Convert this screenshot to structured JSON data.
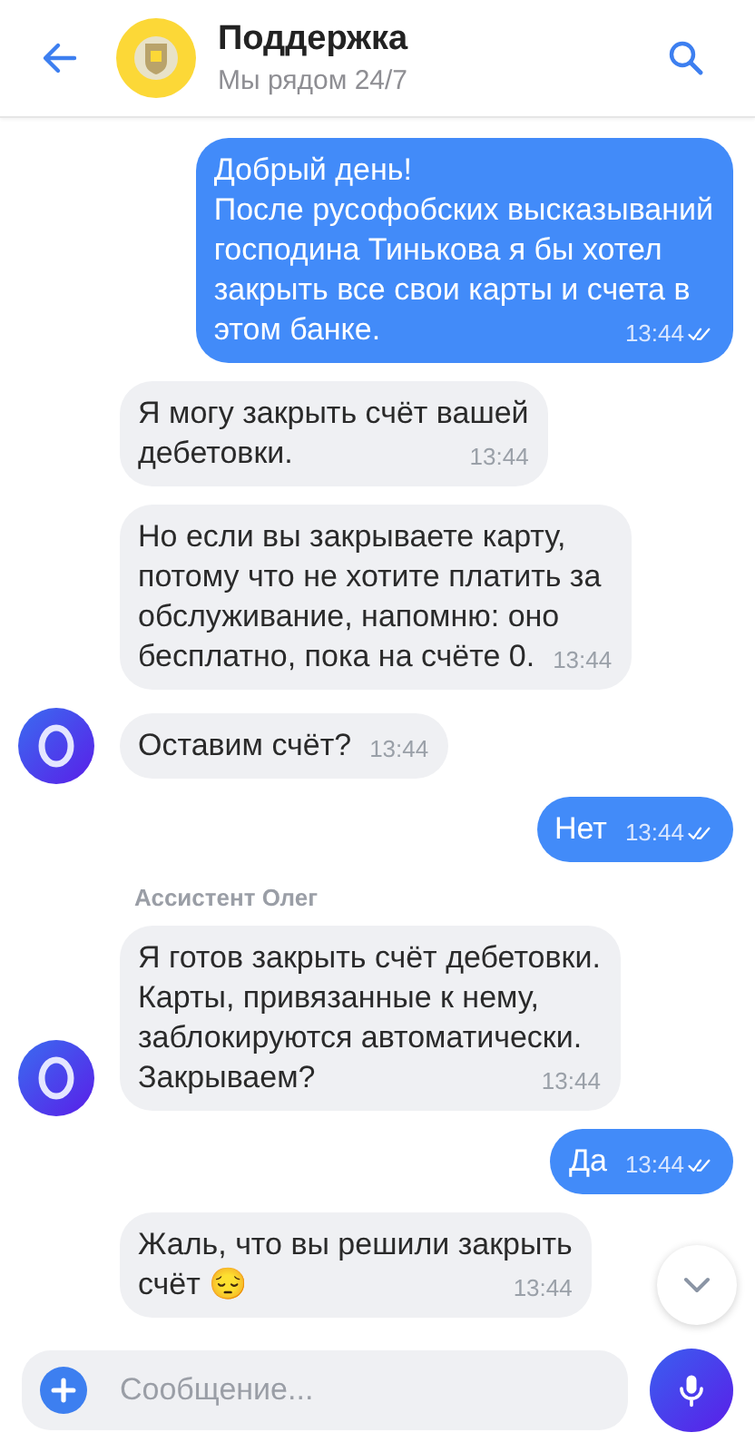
{
  "header": {
    "title": "Поддержка",
    "subtitle": "Мы рядом 24/7"
  },
  "messages": [
    {
      "kind": "out",
      "text": "Добрый день!\nПосле русофобских высказываний\nгосподина Тинькова я бы хотел\nзакрыть все свои карты и счета в\nэтом банке.",
      "time": "13:44",
      "read": true
    },
    {
      "kind": "in",
      "text": "Я могу закрыть счёт вашей\nдебетовки.",
      "time": "13:44",
      "avatar": false
    },
    {
      "kind": "in",
      "text": "Но если вы закрываете карту,\nпотому что не хотите платить за\nобслуживание, напомню: оно\nбесплатно, пока на счёте 0.",
      "time": "13:44",
      "avatar": false
    },
    {
      "kind": "in",
      "text": "Оставим счёт?",
      "time": "13:44",
      "avatar": true
    },
    {
      "kind": "out",
      "text": "Нет",
      "time": "13:44",
      "read": true
    },
    {
      "kind": "sender",
      "text": "Ассистент Олег"
    },
    {
      "kind": "in",
      "text": "Я готов закрыть счёт дебетовки.\nКарты, привязанные к нему,\nзаблокируются автоматически.\nЗакрываем?",
      "time": "13:44",
      "avatar": true
    },
    {
      "kind": "out",
      "text": "Да",
      "time": "13:44",
      "read": true
    },
    {
      "kind": "in",
      "text": "Жаль, что вы решили закрыть\nсчёт 😔",
      "time": "13:44",
      "avatar": false
    }
  ],
  "composer": {
    "placeholder": "Сообщение..."
  }
}
